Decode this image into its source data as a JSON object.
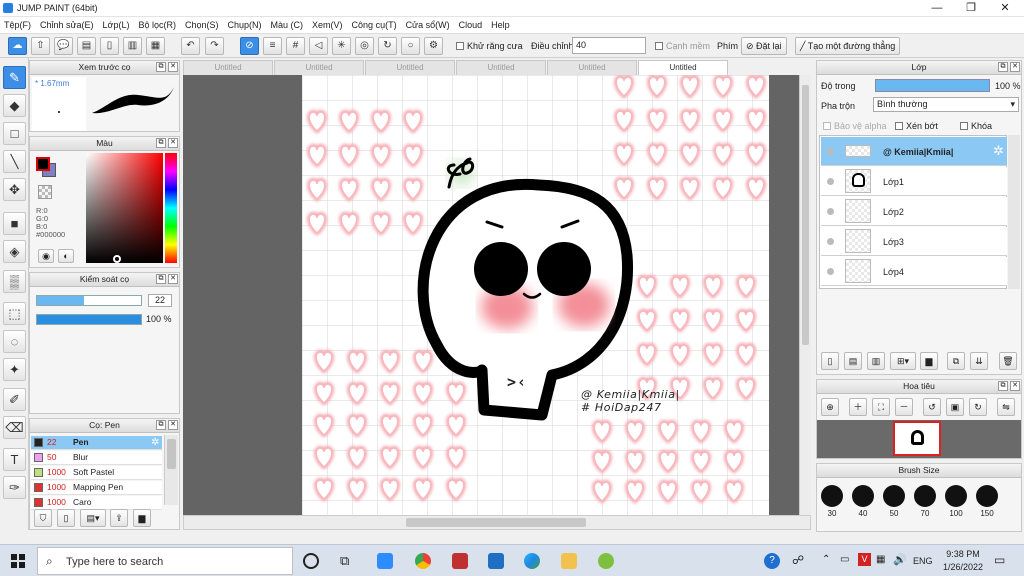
{
  "window": {
    "title": "JUMP PAINT (64bit)",
    "min": "—",
    "max": "❐",
    "close": "✕"
  },
  "menu": [
    "Tệp(F)",
    "Chỉnh sửa(E)",
    "Lớp(L)",
    "Bộ lọc(R)",
    "Chọn(S)",
    "Chụp(N)",
    "Màu (C)",
    "Xem(V)",
    "Công cụ(T)",
    "Cửa sổ(W)",
    "Cloud",
    "Help"
  ],
  "toolbar": {
    "antialias_label": "Khử răng cưa",
    "adjust_label": "Điều chỉnh",
    "adjust_value": "40",
    "edge_label": "Cạnh mềm",
    "key_label": "Phím",
    "reset_label": "Đặt lại",
    "straight_label": "Tạo một đường thẳng"
  },
  "brush_preview": {
    "title": "Xem trước cọ",
    "size": "* 1.67mm"
  },
  "color_panel": {
    "title": "Màu",
    "r": "R:0",
    "g": "G:0",
    "b": "B:0",
    "hex": "#000000",
    "fg": "#000000",
    "bg": "#8080c0"
  },
  "brush_control": {
    "title": "Kiểm soát cọ",
    "size_value": "22",
    "opacity_value": "100 %",
    "size_frac": 0.45,
    "opacity_frac": 1.0
  },
  "brush_list": {
    "title": "Cọ: Pen",
    "items": [
      {
        "size": "22",
        "name": "Pen",
        "color": "#222222",
        "selected": true
      },
      {
        "size": "50",
        "name": "Blur",
        "color": "#f0a0f0",
        "selected": false
      },
      {
        "size": "1000",
        "name": "Soft Pastel",
        "color": "#c0e080",
        "selected": false
      },
      {
        "size": "1000",
        "name": "Mapping Pen",
        "color": "#e03030",
        "selected": false
      },
      {
        "size": "1000",
        "name": "Caro",
        "color": "#e03030",
        "selected": false
      }
    ]
  },
  "tabs": [
    "Untitled",
    "Untitled",
    "Untitled",
    "Untitled",
    "Untitled",
    "Untitled"
  ],
  "canvas": {
    "watermark_line1": "@ Kemiia|Kmiia|",
    "watermark_line2": "# HoiDap247",
    "face_mouth": ">‹"
  },
  "layers_panel": {
    "title": "Lớp",
    "opacity_label": "Độ trong",
    "opacity_value": "100 %",
    "blend_label": "Pha trộn",
    "blend_value": "Bình thường",
    "protect_alpha": "Bảo vệ alpha",
    "clip_label": "Xén bớt",
    "lock_label": "Khóa",
    "layers": [
      {
        "name": "@ Kemiia|Kmiia|",
        "selected": true
      },
      {
        "name": "Lớp1",
        "selected": false
      },
      {
        "name": "Lớp2",
        "selected": false
      },
      {
        "name": "Lớp3",
        "selected": false
      },
      {
        "name": "Lớp4",
        "selected": false
      }
    ]
  },
  "navigator": {
    "title": "Hoa tiêu"
  },
  "brush_size_panel": {
    "title": "Brush Size",
    "sizes": [
      "30",
      "40",
      "50",
      "70",
      "100",
      "150"
    ]
  },
  "taskbar": {
    "search_placeholder": "Type here to search",
    "time": "9:38 PM",
    "date": "1/26/2022",
    "lang": "ENG"
  }
}
